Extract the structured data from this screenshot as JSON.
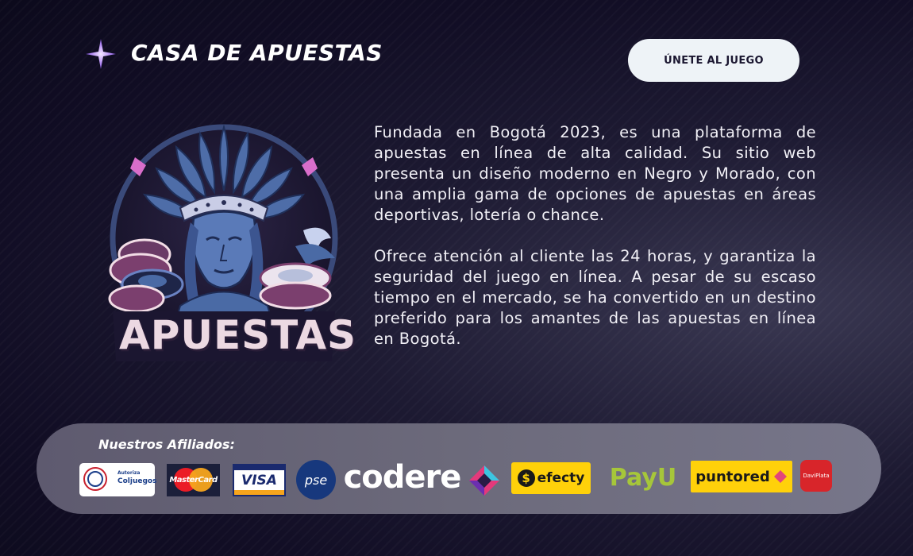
{
  "header": {
    "title": "CASA DE APUESTAS",
    "cta_label": "ÚNETE AL JUEGO"
  },
  "logo": {
    "word": "APUESTAS"
  },
  "description": {
    "paragraphs": [
      "Fundada en Bogotá 2023, es una plataforma de apuestas en línea de alta calidad. Su sitio web presenta un diseño moderno en Negro y Morado, con una amplia gama de opciones de apuestas en áreas deportivas, lotería o chance.",
      "Ofrece atención al cliente las 24 horas,  y garantiza la seguridad del juego en línea. A pesar de su escaso tiempo en el mercado, se ha convertido en un destino preferido para los amantes de las apuestas en línea en Bogotá."
    ]
  },
  "affiliates": {
    "title": "Nuestros Afiliados:",
    "partners": {
      "coljuegos": "Coljuegos",
      "coljuegos_top": "Autoriza",
      "mastercard": "MasterCard",
      "visa": "VISA",
      "pse": "pse",
      "codere": "codere",
      "efecty": "efecty",
      "payu": "PayU",
      "puntored": "puntored",
      "daviplata": "DaviPlata"
    }
  },
  "colors": {
    "background": "#110d24",
    "accent_purple": "#b07cf0",
    "button_bg": "#eef3f7",
    "band_bg": "#6c6a7b",
    "efecty_yellow": "#ffd10a",
    "payu_green": "#a6c63a",
    "daviplata_red": "#d8252a"
  },
  "icons": {
    "sparkle": "sparkle-icon",
    "logo": "warrior-casino-logo"
  }
}
